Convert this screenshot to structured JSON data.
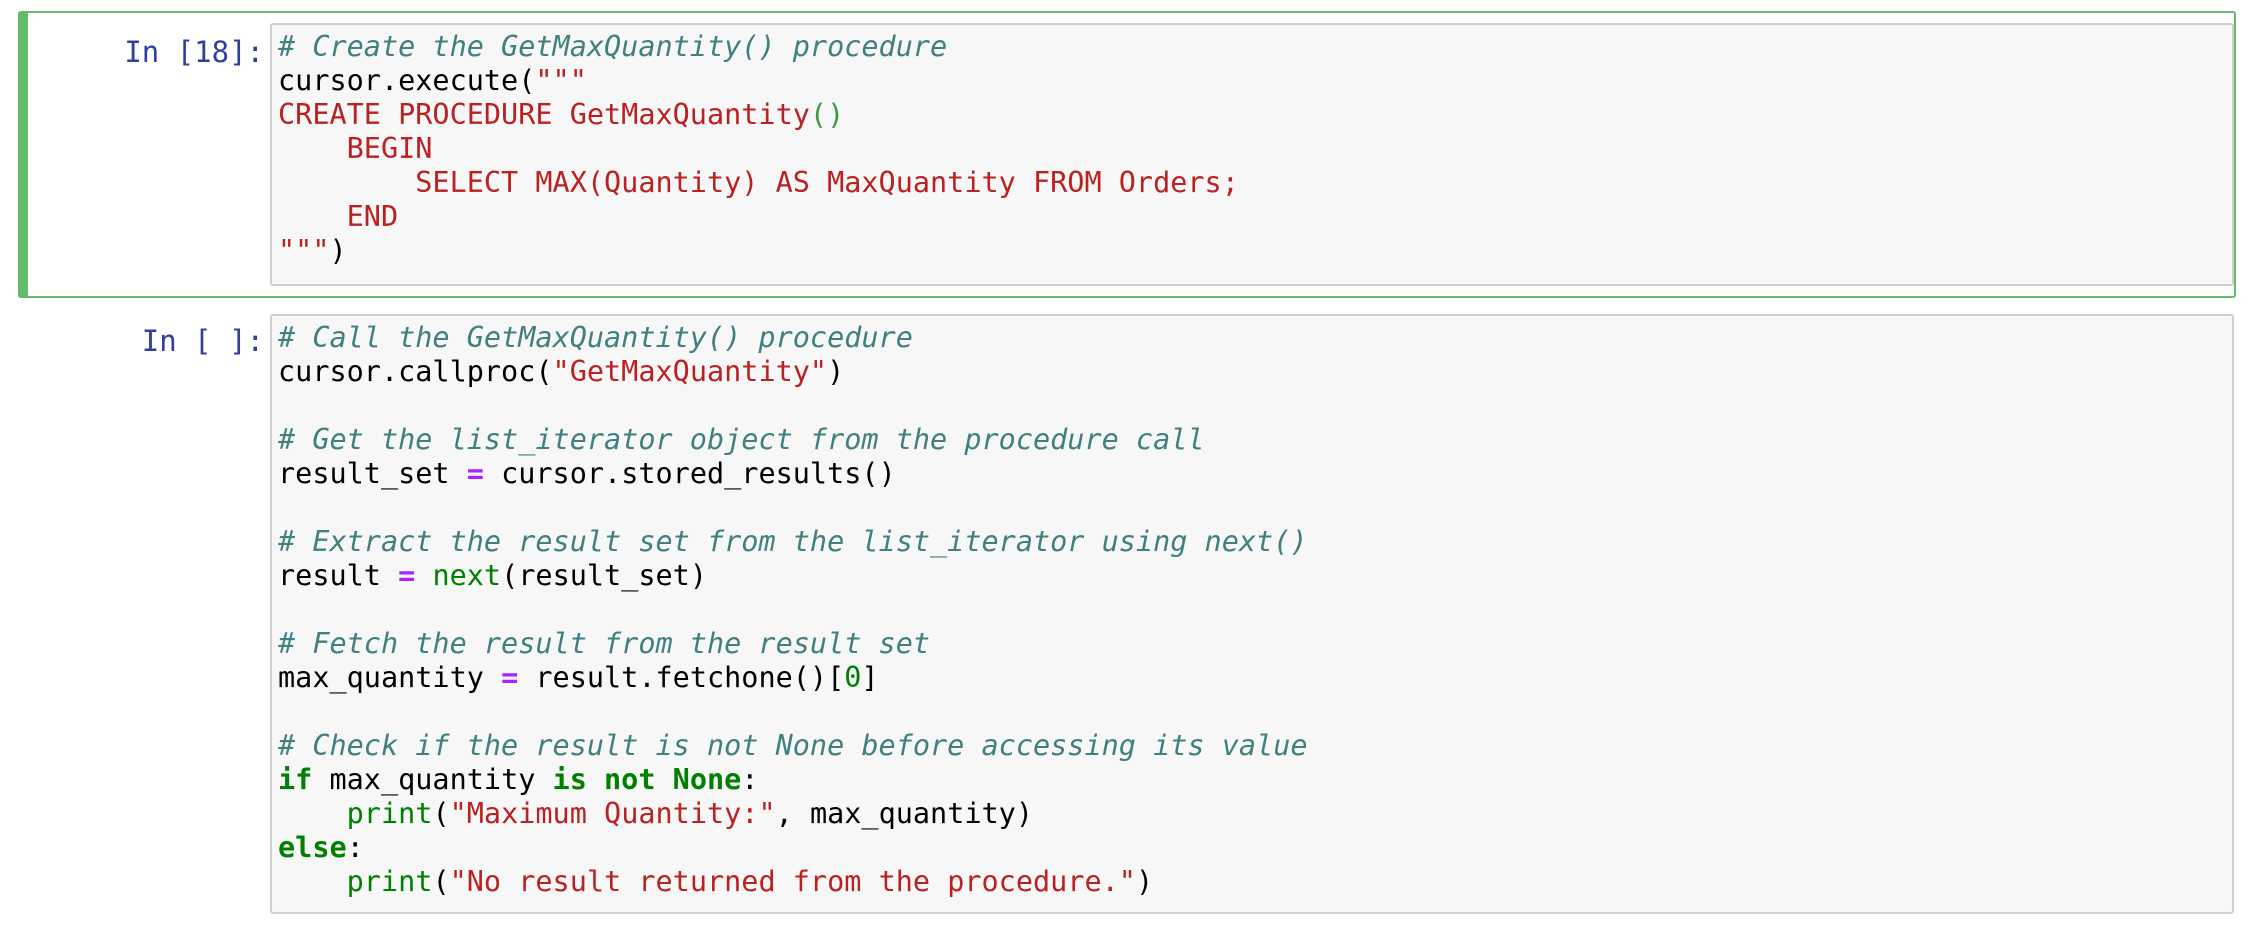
{
  "colors": {
    "selected_border": "#66bb6a",
    "prompt": "#303f9f",
    "comment": "#408080",
    "string": "#ba2121",
    "keyword": "#008000",
    "operator": "#aa22ff",
    "input_bg": "#f7f7f7"
  },
  "cells": [
    {
      "prompt": "In [18]:",
      "selected": true,
      "lines": [
        [
          {
            "t": "comment",
            "v": "# Create the GetMaxQuantity() procedure"
          }
        ],
        [
          {
            "t": "plain",
            "v": "cursor.execute("
          },
          {
            "t": "string",
            "v": "\"\"\""
          }
        ],
        [
          {
            "t": "string",
            "v": "CREATE PROCEDURE GetMaxQuantity"
          },
          {
            "t": "paren-green",
            "v": "()"
          }
        ],
        [
          {
            "t": "string",
            "v": "    BEGIN"
          }
        ],
        [
          {
            "t": "string",
            "v": "        SELECT MAX(Quantity) AS MaxQuantity FROM Orders;"
          }
        ],
        [
          {
            "t": "string",
            "v": "    END"
          }
        ],
        [
          {
            "t": "string",
            "v": "\"\"\""
          },
          {
            "t": "plain",
            "v": ")"
          }
        ]
      ]
    },
    {
      "prompt": "In [ ]:",
      "selected": false,
      "lines": [
        [
          {
            "t": "comment",
            "v": "# Call the GetMaxQuantity() procedure"
          }
        ],
        [
          {
            "t": "plain",
            "v": "cursor.callproc("
          },
          {
            "t": "string",
            "v": "\"GetMaxQuantity\""
          },
          {
            "t": "plain",
            "v": ")"
          }
        ],
        [],
        [
          {
            "t": "comment",
            "v": "# Get the list_iterator object from the procedure call"
          }
        ],
        [
          {
            "t": "plain",
            "v": "result_set "
          },
          {
            "t": "operator",
            "v": "="
          },
          {
            "t": "plain",
            "v": " cursor.stored_results()"
          }
        ],
        [],
        [
          {
            "t": "comment",
            "v": "# Extract the result set from the list_iterator using next()"
          }
        ],
        [
          {
            "t": "plain",
            "v": "result "
          },
          {
            "t": "operator",
            "v": "="
          },
          {
            "t": "plain",
            "v": " "
          },
          {
            "t": "builtin",
            "v": "next"
          },
          {
            "t": "plain",
            "v": "(result_set)"
          }
        ],
        [],
        [
          {
            "t": "comment",
            "v": "# Fetch the result from the result set"
          }
        ],
        [
          {
            "t": "plain",
            "v": "max_quantity "
          },
          {
            "t": "operator",
            "v": "="
          },
          {
            "t": "plain",
            "v": " result.fetchone()["
          },
          {
            "t": "number",
            "v": "0"
          },
          {
            "t": "plain",
            "v": "]"
          }
        ],
        [],
        [
          {
            "t": "comment",
            "v": "# Check if the result is not None before accessing its value"
          }
        ],
        [
          {
            "t": "keyword",
            "v": "if"
          },
          {
            "t": "plain",
            "v": " max_quantity "
          },
          {
            "t": "keyword",
            "v": "is not None"
          },
          {
            "t": "plain",
            "v": ":"
          }
        ],
        [
          {
            "t": "plain",
            "v": "    "
          },
          {
            "t": "builtin",
            "v": "print"
          },
          {
            "t": "plain",
            "v": "("
          },
          {
            "t": "string",
            "v": "\"Maximum Quantity:\""
          },
          {
            "t": "plain",
            "v": ", max_quantity)"
          }
        ],
        [
          {
            "t": "keyword",
            "v": "else"
          },
          {
            "t": "plain",
            "v": ":"
          }
        ],
        [
          {
            "t": "plain",
            "v": "    "
          },
          {
            "t": "builtin",
            "v": "print"
          },
          {
            "t": "plain",
            "v": "("
          },
          {
            "t": "string",
            "v": "\"No result returned from the procedure.\""
          },
          {
            "t": "plain",
            "v": ")"
          }
        ]
      ]
    }
  ]
}
